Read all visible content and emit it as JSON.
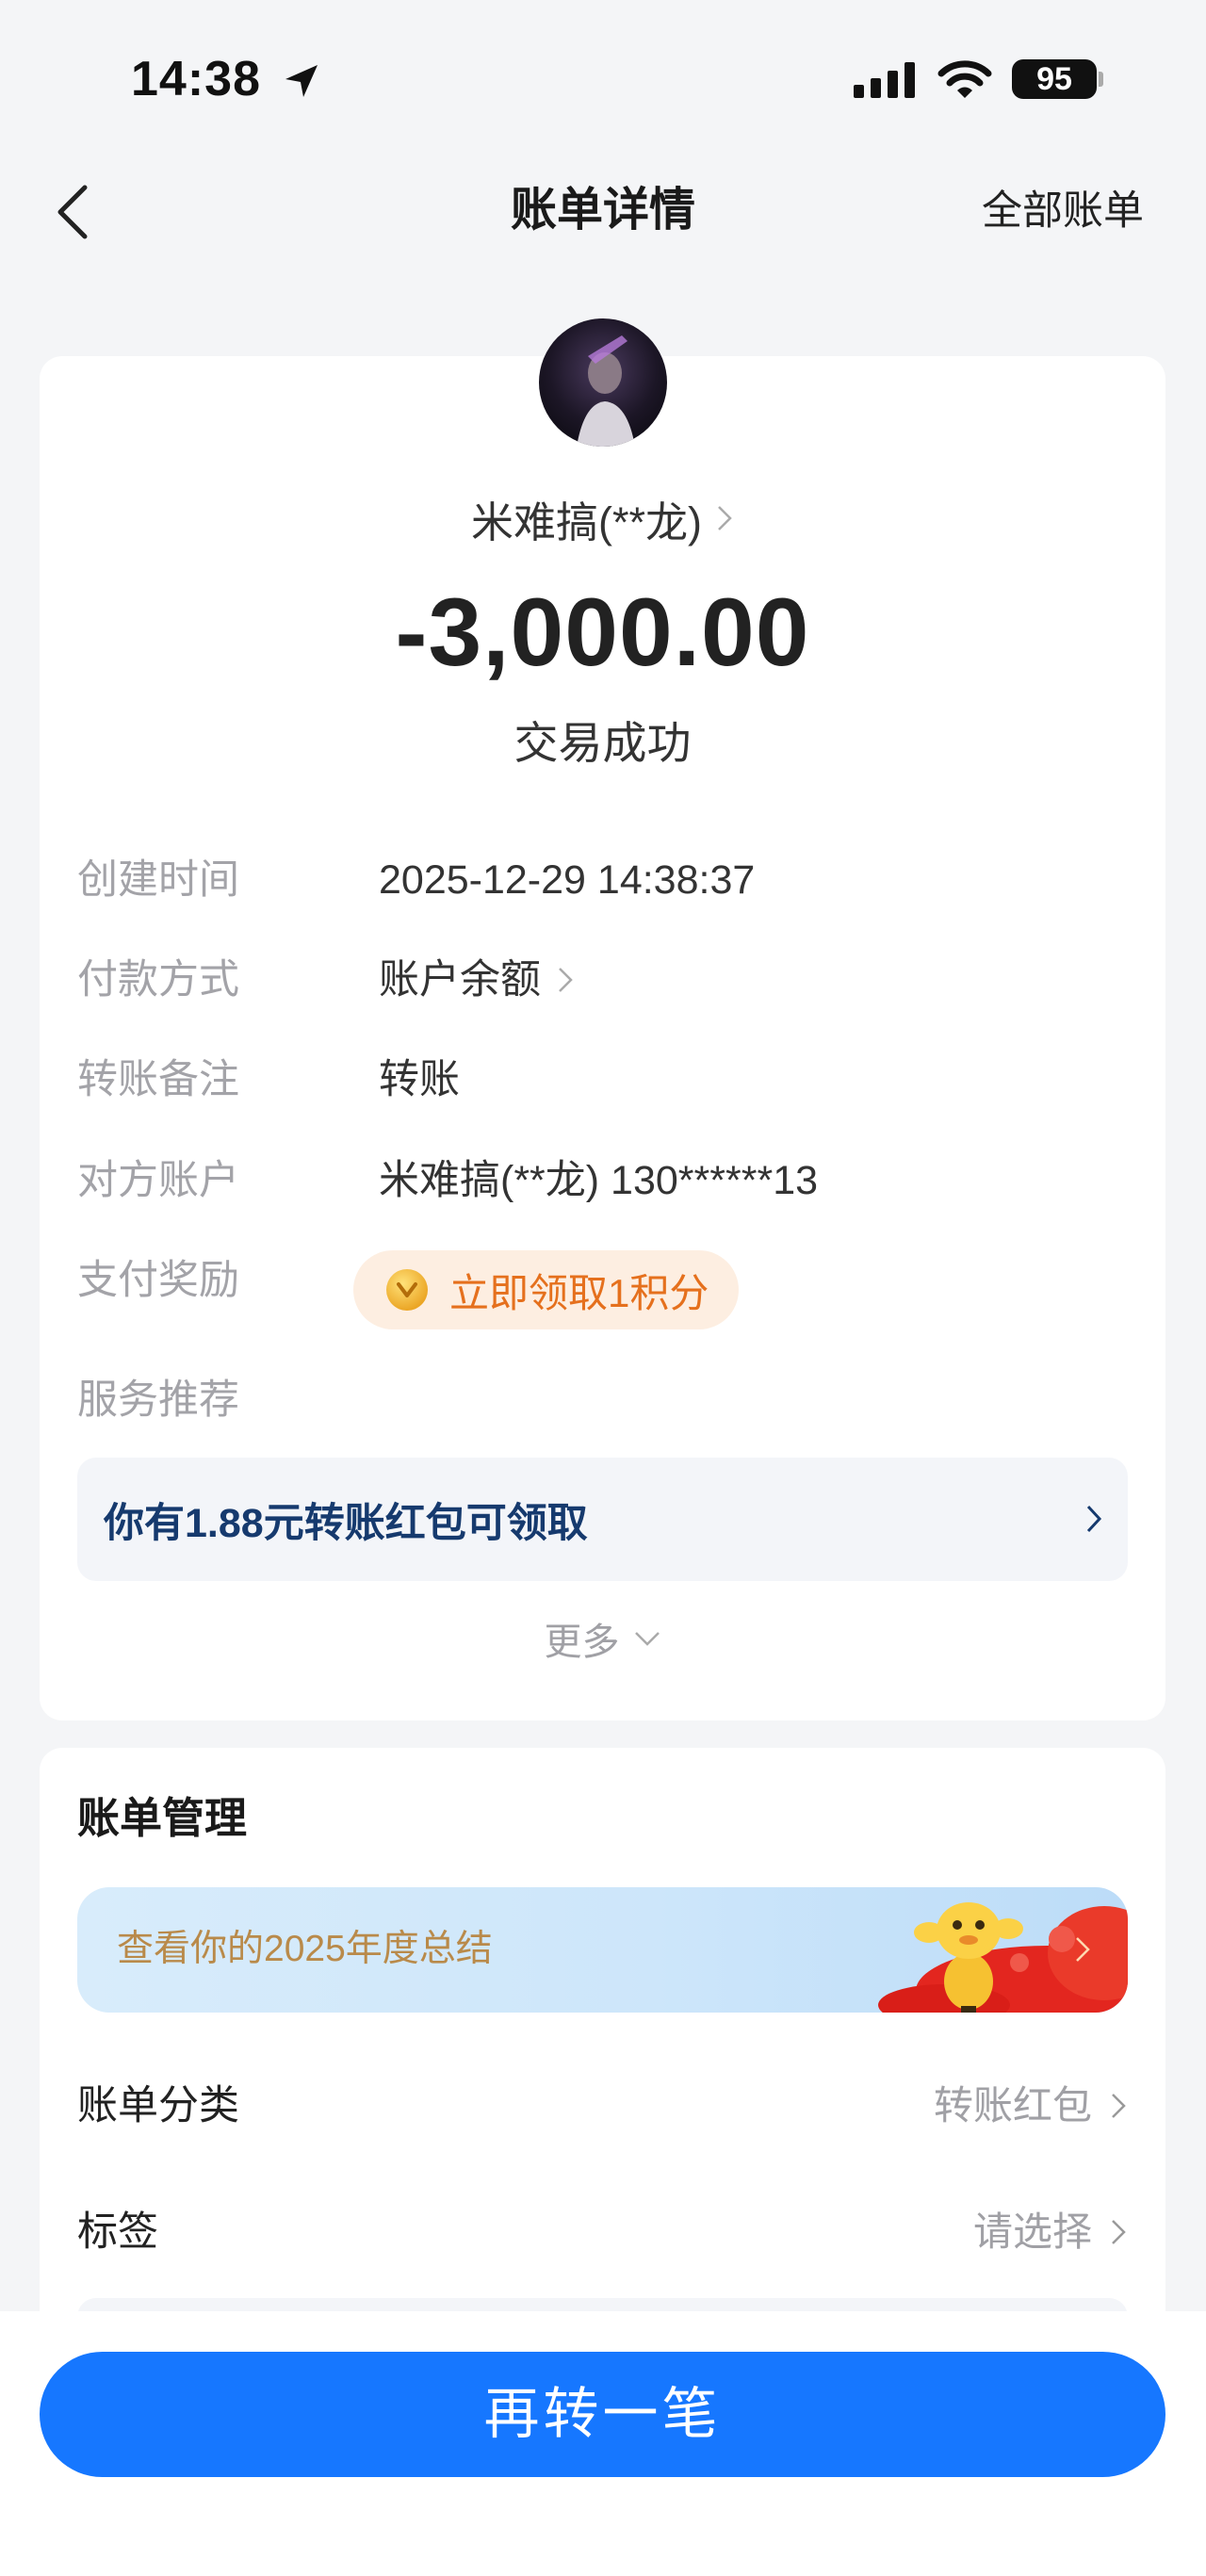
{
  "status_bar": {
    "time": "14:38",
    "battery": "95"
  },
  "nav": {
    "title": "账单详情",
    "right_link": "全部账单"
  },
  "transaction": {
    "counterparty": "米难搞(**龙)",
    "amount": "-3,000.00",
    "status": "交易成功"
  },
  "details": [
    {
      "label": "创建时间",
      "value": "2025-12-29 14:38:37"
    },
    {
      "label": "付款方式",
      "value": "账户余额"
    },
    {
      "label": "转账备注",
      "value": "转账"
    },
    {
      "label": "对方账户",
      "value": "米难搞(**龙) 130******13"
    }
  ],
  "reward": {
    "label": "支付奖励",
    "button": "立即领取1积分"
  },
  "service": {
    "label": "服务推荐",
    "promo": "你有1.88元转账红包可领取",
    "more": "更多"
  },
  "bill_management": {
    "title": "账单管理",
    "banner": "查看你的2025年度总结",
    "rows": [
      {
        "label": "账单分类",
        "value": "转账红包"
      },
      {
        "label": "标签",
        "value": "请选择"
      }
    ]
  },
  "action_button": "再转一笔",
  "icons": [
    "location-arrow-icon",
    "signal-icon",
    "wifi-icon",
    "battery-icon",
    "back-chevron-icon",
    "chevron-right-icon",
    "chevron-down-icon",
    "points-coin-icon"
  ],
  "colors": {
    "primary": "#1677ff",
    "reward_text": "#e5701d",
    "promo_text": "#163a6e",
    "banner_text": "#b98a4a",
    "background": "#f4f5f7"
  }
}
